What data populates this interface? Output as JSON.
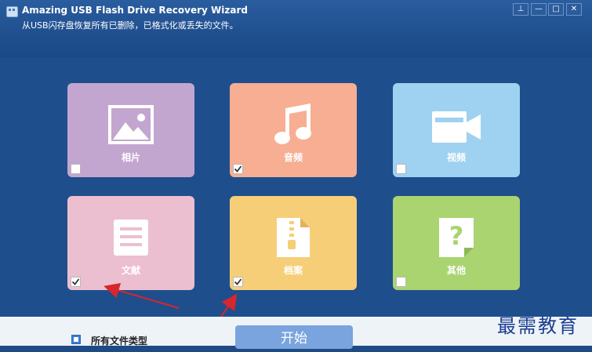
{
  "window": {
    "title": "Amazing USB Flash Drive Recovery Wizard",
    "subtitle": "从USB闪存盘恢复所有已删除，已格式化或丢失的文件。",
    "controls": [
      "⊥",
      "—",
      "□",
      "✕"
    ]
  },
  "tiles": [
    {
      "label": "相片",
      "icon": "image-icon",
      "checked": false,
      "color": "#c3a6d0"
    },
    {
      "label": "音频",
      "icon": "music-note-icon",
      "checked": true,
      "color": "#f7ae93"
    },
    {
      "label": "视频",
      "icon": "video-camera-icon",
      "checked": false,
      "color": "#9fd1f0"
    },
    {
      "label": "文献",
      "icon": "document-icon",
      "checked": true,
      "color": "#ecbfd0"
    },
    {
      "label": "档案",
      "icon": "archive-zip-icon",
      "checked": true,
      "color": "#f6ce78"
    },
    {
      "label": "其他",
      "icon": "question-file-icon",
      "checked": false,
      "color": "#a9d46f"
    }
  ],
  "footer": {
    "all_types_label": "所有文件类型",
    "start_label": "开始"
  },
  "watermark": "最需教育"
}
